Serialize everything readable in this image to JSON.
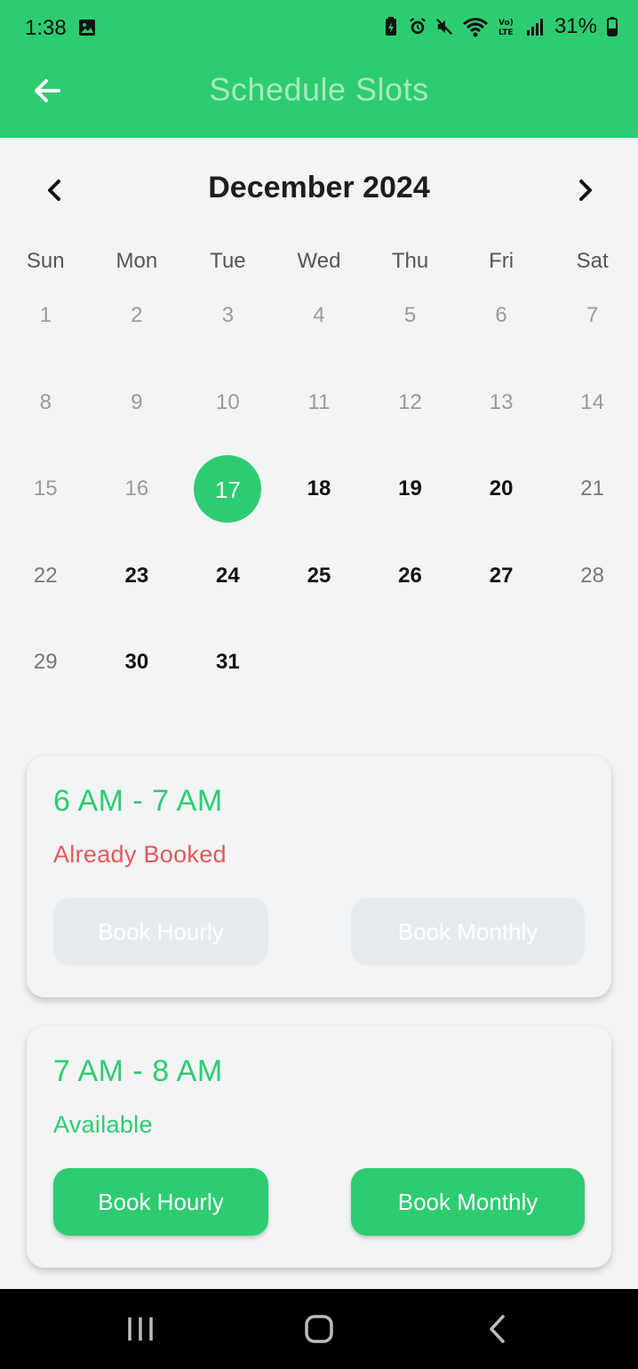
{
  "status_bar": {
    "time": "1:38",
    "battery": "31%"
  },
  "app_bar": {
    "title": "Schedule Slots",
    "back_icon": "arrow-left-icon"
  },
  "calendar": {
    "month_label": "December 2024",
    "prev_icon": "chevron-left-icon",
    "next_icon": "chevron-right-icon",
    "weekdays": [
      "Sun",
      "Mon",
      "Tue",
      "Wed",
      "Thu",
      "Fri",
      "Sat"
    ],
    "days": [
      {
        "n": "1",
        "style": "past"
      },
      {
        "n": "2",
        "style": "past"
      },
      {
        "n": "3",
        "style": "past"
      },
      {
        "n": "4",
        "style": "past"
      },
      {
        "n": "5",
        "style": "past"
      },
      {
        "n": "6",
        "style": "past"
      },
      {
        "n": "7",
        "style": "past"
      },
      {
        "n": "8",
        "style": "past"
      },
      {
        "n": "9",
        "style": "past"
      },
      {
        "n": "10",
        "style": "past"
      },
      {
        "n": "11",
        "style": "past"
      },
      {
        "n": "12",
        "style": "past"
      },
      {
        "n": "13",
        "style": "past"
      },
      {
        "n": "14",
        "style": "past"
      },
      {
        "n": "15",
        "style": "past"
      },
      {
        "n": "16",
        "style": "past"
      },
      {
        "n": "17",
        "style": "selected"
      },
      {
        "n": "18",
        "style": "bold"
      },
      {
        "n": "19",
        "style": "bold"
      },
      {
        "n": "20",
        "style": "bold"
      },
      {
        "n": "21",
        "style": "weekend"
      },
      {
        "n": "22",
        "style": "weekend"
      },
      {
        "n": "23",
        "style": "bold"
      },
      {
        "n": "24",
        "style": "bold"
      },
      {
        "n": "25",
        "style": "bold"
      },
      {
        "n": "26",
        "style": "bold"
      },
      {
        "n": "27",
        "style": "bold"
      },
      {
        "n": "28",
        "style": "weekend"
      },
      {
        "n": "29",
        "style": "weekend"
      },
      {
        "n": "30",
        "style": "bold"
      },
      {
        "n": "31",
        "style": "bold"
      }
    ],
    "selected_day": "17"
  },
  "slots": [
    {
      "time": "6 AM - 7 AM",
      "status": "Already Booked",
      "status_type": "booked",
      "hourly_label": "Book Hourly",
      "monthly_label": "Book Monthly",
      "enabled": false
    },
    {
      "time": "7 AM - 8 AM",
      "status": "Available",
      "status_type": "available",
      "hourly_label": "Book Hourly",
      "monthly_label": "Book Monthly",
      "enabled": true
    }
  ],
  "colors": {
    "primary": "#2ecc71",
    "booked": "#e35a5a",
    "background": "#f2f4f6"
  },
  "nav_bar": {
    "recent_icon": "recent-apps-icon",
    "home_icon": "home-icon",
    "back_icon": "back-icon"
  }
}
